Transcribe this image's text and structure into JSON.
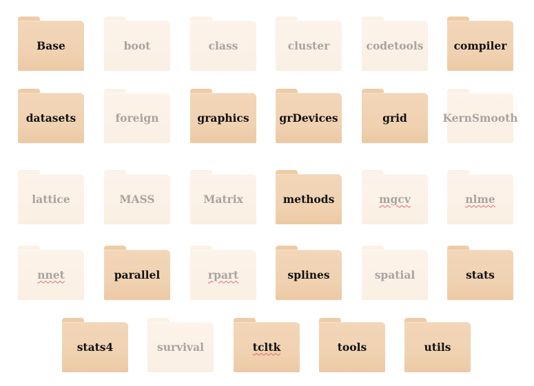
{
  "packages": [
    {
      "label": "Base",
      "active": true,
      "spell": false
    },
    {
      "label": "boot",
      "active": false,
      "spell": false
    },
    {
      "label": "class",
      "active": false,
      "spell": false
    },
    {
      "label": "cluster",
      "active": false,
      "spell": false
    },
    {
      "label": "codetools",
      "active": false,
      "spell": false
    },
    {
      "label": "compiler",
      "active": true,
      "spell": false
    },
    {
      "label": "datasets",
      "active": true,
      "spell": false
    },
    {
      "label": "foreign",
      "active": false,
      "spell": false
    },
    {
      "label": "graphics",
      "active": true,
      "spell": false
    },
    {
      "label": "grDevices",
      "active": true,
      "spell": false
    },
    {
      "label": "grid",
      "active": true,
      "spell": false
    },
    {
      "label": "KernSmooth",
      "active": false,
      "spell": false
    },
    {
      "label": "lattice",
      "active": false,
      "spell": false
    },
    {
      "label": "MASS",
      "active": false,
      "spell": false
    },
    {
      "label": "Matrix",
      "active": false,
      "spell": false
    },
    {
      "label": "methods",
      "active": true,
      "spell": false
    },
    {
      "label": "mgcv",
      "active": false,
      "spell": true
    },
    {
      "label": "nlme",
      "active": false,
      "spell": true
    },
    {
      "label": "nnet",
      "active": false,
      "spell": true
    },
    {
      "label": "parallel",
      "active": true,
      "spell": false
    },
    {
      "label": "rpart",
      "active": false,
      "spell": true
    },
    {
      "label": "splines",
      "active": true,
      "spell": false
    },
    {
      "label": "spatial",
      "active": false,
      "spell": false
    },
    {
      "label": "stats",
      "active": true,
      "spell": false
    },
    {
      "label": "stats4",
      "active": true,
      "spell": false
    },
    {
      "label": "survival",
      "active": false,
      "spell": false
    },
    {
      "label": "tcltk",
      "active": true,
      "spell": true
    },
    {
      "label": "tools",
      "active": true,
      "spell": false
    },
    {
      "label": "utils",
      "active": true,
      "spell": false
    }
  ]
}
